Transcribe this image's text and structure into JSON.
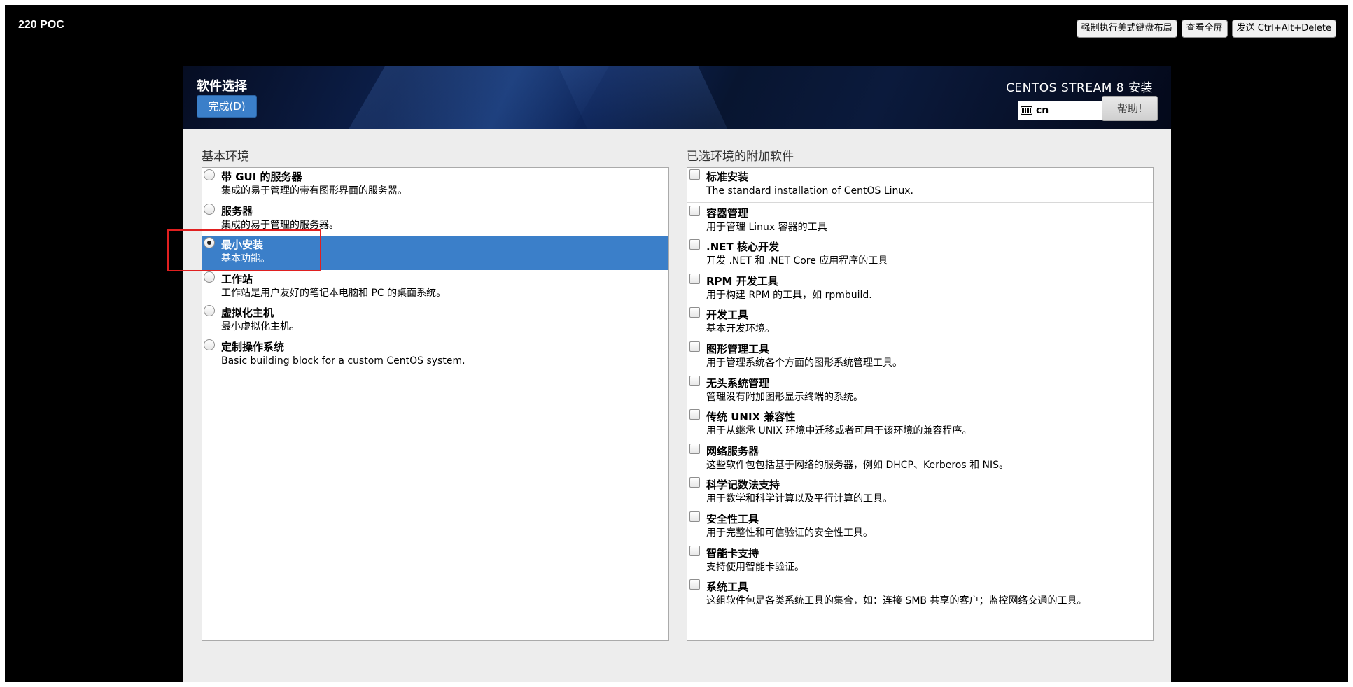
{
  "console": {
    "title": "220 POC",
    "buttons": [
      "强制执行美式键盘布局",
      "查看全屏",
      "发送 Ctrl+Alt+Delete"
    ]
  },
  "header": {
    "page_title": "软件选择",
    "done_label": "完成(D)",
    "product_title": "CENTOS STREAM 8 安装",
    "keyboard_layout": "cn",
    "help_label": "帮助!"
  },
  "environments": {
    "label": "基本环境",
    "items": [
      {
        "name": "带 GUI 的服务器",
        "desc": "集成的易于管理的带有图形界面的服务器。"
      },
      {
        "name": "服务器",
        "desc": "集成的易于管理的服务器。"
      },
      {
        "name": "最小安装",
        "desc": "基本功能。"
      },
      {
        "name": "工作站",
        "desc": "工作站是用户友好的笔记本电脑和 PC 的桌面系统。"
      },
      {
        "name": "虚拟化主机",
        "desc": "最小虚拟化主机。"
      },
      {
        "name": "定制操作系统",
        "desc": "Basic building block for a custom CentOS system."
      }
    ]
  },
  "addons": {
    "label": "已选环境的附加软件",
    "items": [
      {
        "name": "标准安装",
        "desc": "The standard installation of CentOS Linux."
      },
      {
        "name": "容器管理",
        "desc": "用于管理 Linux 容器的工具"
      },
      {
        "name": ".NET 核心开发",
        "desc": "开发 .NET 和 .NET Core 应用程序的工具"
      },
      {
        "name": "RPM 开发工具",
        "desc": "用于构建 RPM 的工具，如 rpmbuild."
      },
      {
        "name": "开发工具",
        "desc": "基本开发环境。"
      },
      {
        "name": "图形管理工具",
        "desc": "用于管理系统各个方面的图形系统管理工具。"
      },
      {
        "name": "无头系统管理",
        "desc": "管理没有附加图形显示终端的系统。"
      },
      {
        "name": "传统 UNIX 兼容性",
        "desc": "用于从继承 UNIX 环境中迁移或者可用于该环境的兼容程序。"
      },
      {
        "name": "网络服务器",
        "desc": "这些软件包包括基于网络的服务器，例如 DHCP、Kerberos 和 NIS。"
      },
      {
        "name": "科学记数法支持",
        "desc": "用于数学和科学计算以及平行计算的工具。"
      },
      {
        "name": "安全性工具",
        "desc": "用于完整性和可信验证的安全性工具。"
      },
      {
        "name": "智能卡支持",
        "desc": "支持使用智能卡验证。"
      },
      {
        "name": "系统工具",
        "desc": "这组软件包是各类系统工具的集合，如：连接 SMB 共享的客户；监控网络交通的工具。"
      }
    ]
  },
  "colors": {
    "selection": "#3b7fc9",
    "annotation_box": "#e02020"
  }
}
